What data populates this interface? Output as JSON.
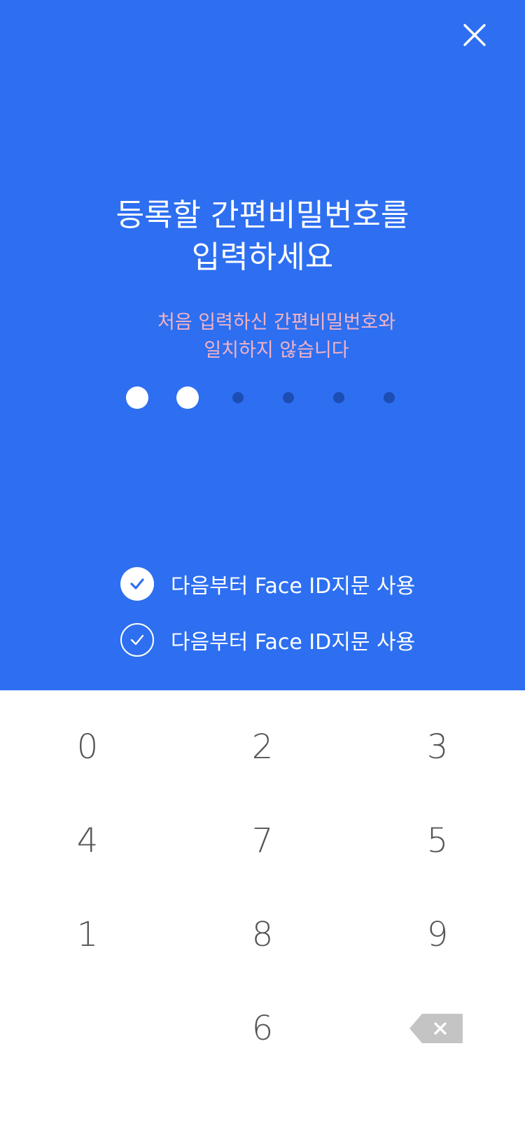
{
  "header": {
    "close_icon": "close-icon"
  },
  "title": {
    "line1": "등록할 간편비밀번호를",
    "line2": "입력하세요"
  },
  "error": {
    "line1": "처음 입력하신 간편비밀번호와",
    "line2": "일치하지 않습니다"
  },
  "pin": {
    "length": 6,
    "entered": 2
  },
  "options": [
    {
      "label": "다음부터 Face ID지문 사용",
      "checked": true
    },
    {
      "label": "다음부터 Face ID지문 사용",
      "checked": false
    }
  ],
  "keypad": {
    "keys": [
      "0",
      "2",
      "3",
      "4",
      "7",
      "5",
      "1",
      "8",
      "9",
      "",
      "6",
      "backspace"
    ],
    "backspace_icon": "backspace-icon"
  },
  "colors": {
    "primary": "#2d6ff0",
    "error_text": "#f2b2c6",
    "dot_empty": "#1d4db3",
    "key_text": "#555555",
    "backspace_fill": "#c4c4c4"
  }
}
